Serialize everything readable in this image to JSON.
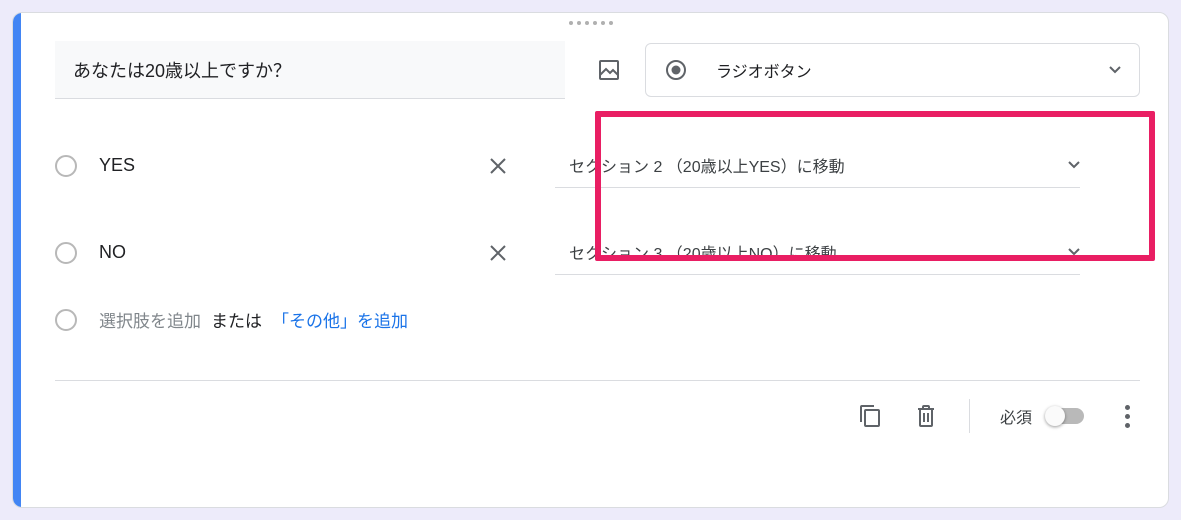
{
  "question": "あなたは20歳以上ですか？",
  "type": {
    "label": "ラジオボタン"
  },
  "options": [
    {
      "text": "YES",
      "goto": "セクション 2 （20歳以上YES）に移動"
    },
    {
      "text": "NO",
      "goto": "セクション 3 （20歳以上NO）に移動"
    }
  ],
  "addOption": "選択肢を追加",
  "addOr": "または",
  "addOther": "「その他」を追加",
  "footer": {
    "required": "必須"
  }
}
